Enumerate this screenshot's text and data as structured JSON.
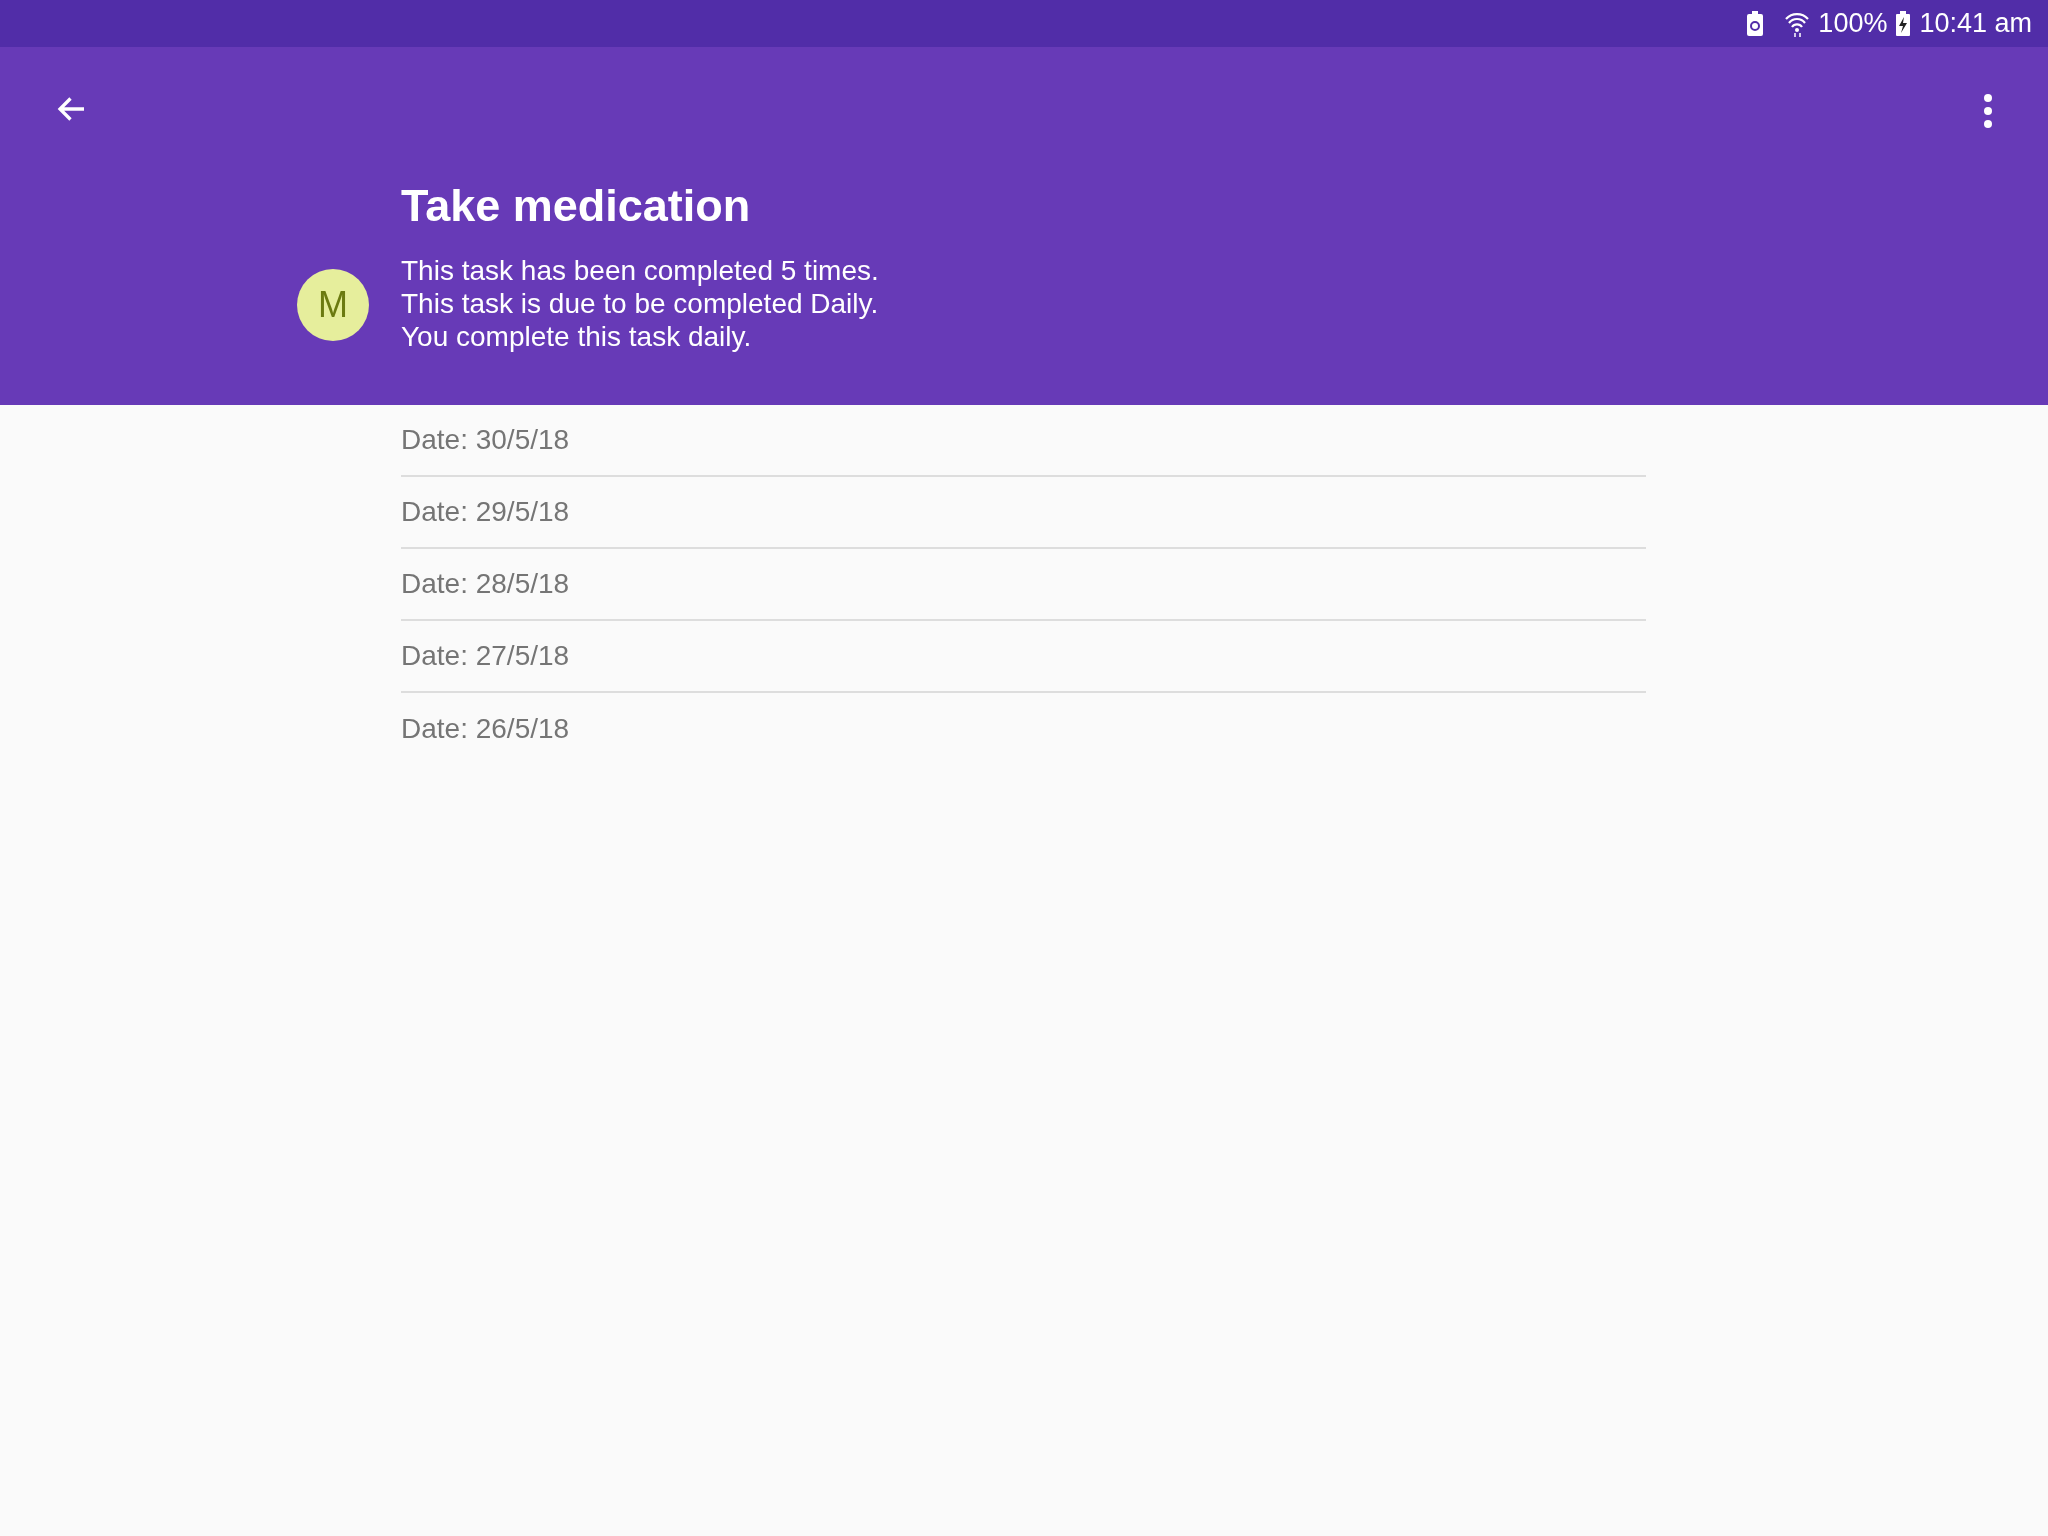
{
  "status_bar": {
    "battery": "100%",
    "time": "10:41 am"
  },
  "header": {
    "title": "Take medication",
    "avatar": {
      "letter": "M",
      "color": "#e6ee9c"
    },
    "lines": [
      "This task has been completed 5 times.",
      "This task is due to be completed Daily.",
      "You complete this task daily."
    ]
  },
  "history": [
    "Date: 30/5/18",
    "Date: 29/5/18",
    "Date: 28/5/18",
    "Date: 27/5/18",
    "Date: 26/5/18"
  ]
}
